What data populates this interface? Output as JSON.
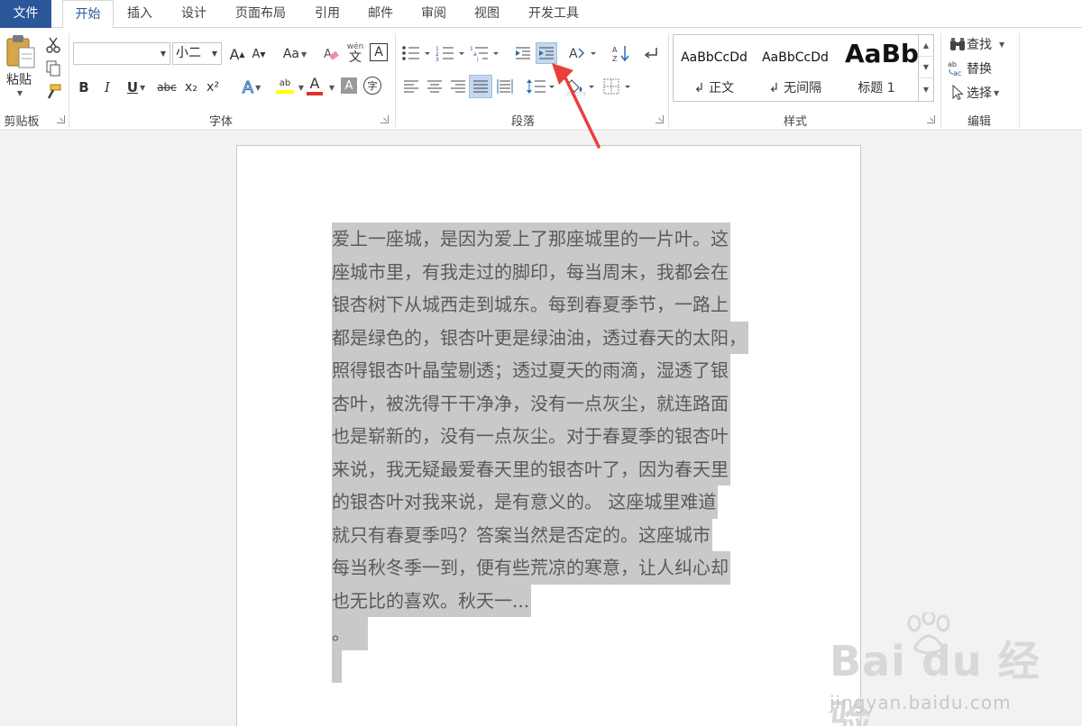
{
  "tabs": {
    "file": "文件",
    "home": "开始",
    "insert": "插入",
    "design": "设计",
    "layout": "页面布局",
    "references": "引用",
    "mailings": "邮件",
    "review": "审阅",
    "view": "视图",
    "developer": "开发工具"
  },
  "clipboard": {
    "paste": "粘贴",
    "label": "剪贴板"
  },
  "font": {
    "name_value": "",
    "size_value": "小二",
    "aa": "Aa",
    "wen": "wén",
    "wen_char": "文",
    "a_box": "A",
    "bold": "B",
    "italic": "I",
    "underline": "U",
    "strike": "abc",
    "sub": "x₂",
    "sup": "x²",
    "hl": "ab",
    "color_a": "A",
    "shade_a": "A",
    "circle": "字",
    "grow": "A",
    "shrink": "A",
    "label": "字体"
  },
  "paragraph": {
    "label": "段落"
  },
  "styles": {
    "items": [
      {
        "sample": "AaBbCcDd",
        "name": "↲ 正文"
      },
      {
        "sample": "AaBbCcDd",
        "name": "↲ 无间隔"
      },
      {
        "sample": "AaBb",
        "name": "标题 1"
      }
    ],
    "label": "样式"
  },
  "editing": {
    "find": "查找",
    "replace": "替换",
    "select": "选择",
    "label": "编辑"
  },
  "document": {
    "lines": [
      "爱上一座城，是因为爱上了那座城里的一片叶。这",
      "座城市里，有我走过的脚印，每当周末，我都会在",
      "银杏树下从城西走到城东。每到春夏季节，一路上",
      "都是绿色的，银杏叶更是绿油油，透过春天的太阳，",
      "照得银杏叶晶莹剔透；透过夏天的雨滴，湿透了银",
      "杏叶，被洗得干干净净，没有一点灰尘，就连路面",
      "也是崭新的，没有一点灰尘。对于春夏季的银杏叶",
      "来说，我无疑最爱春天里的银杏叶了，因为春天里",
      "的银杏叶对我来说，是有意义的。 这座城里难道",
      "就只有春夏季吗？答案当然是否定的。这座城市",
      "每当秋冬季一到，便有些荒凉的寒意，让人纠心却",
      "也无比的喜欢。秋天一...",
      "。",
      ""
    ]
  },
  "watermark": {
    "logo": "Bai du 经验",
    "url": "jingyan.baidu.com"
  },
  "colors": {
    "file_tab": "#2b579a",
    "selection": "#c9c9c9",
    "arrow": "#e8413a",
    "indent_active": "#c5d8f0"
  }
}
